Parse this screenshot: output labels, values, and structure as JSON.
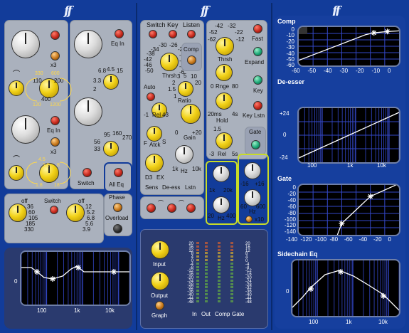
{
  "logo": "ff",
  "left": {
    "buttons": [
      "Switch",
      "All Eq",
      "Phase",
      "Overload"
    ],
    "eq_in_1": "Eq In",
    "eq_in_2": "Eq In",
    "eq_in_3": "Eq In",
    "x3_a": "x3",
    "x3_b": "x3",
    "band1_scale": [
      "330",
      "600",
      "110",
      "200",
      "400",
      "120",
      "1200"
    ],
    "band2_scale": [
      "4.5",
      "1.5",
      "8",
      "1.8",
      "18"
    ],
    "band3_scale": [
      "4.5",
      "6.8",
      "10",
      "15",
      "3.3",
      "2"
    ],
    "band4_scale": [
      "95",
      "160",
      "270",
      "56",
      "33"
    ],
    "hpf_switch": "Switch",
    "hpf1_scale": [
      "off",
      "36",
      "60",
      "105",
      "185",
      "330"
    ],
    "hpf2_scale": [
      "off",
      "12",
      "5.2",
      "6.8",
      "5.6",
      "3.9"
    ],
    "eq_graph": {
      "y_label": "0",
      "x_labels": [
        "100",
        "1k",
        "10k"
      ]
    }
  },
  "mid": {
    "tabs": [
      "Switch",
      "Key",
      "Listen"
    ],
    "comp_button": "Comp",
    "comp_thresh_scale": [
      "-30",
      "-26",
      "-22",
      "-34",
      "-18",
      "-38",
      "-14",
      "-42",
      "-10",
      "-46",
      "-6",
      "-50"
    ],
    "thrsh": "Thrsh",
    "auto": "Auto",
    "ratio": "Ratio",
    "ratio_scale": [
      "3",
      "5",
      "10",
      "2",
      "20",
      "1.5",
      "1"
    ],
    "rel": "Rel",
    "rel_scale": [
      "-1",
      "43"
    ],
    "atck": "Atck",
    "atck_scale": [
      "F",
      "S"
    ],
    "gain": "Gain",
    "gain_scale": [
      "0",
      "+20"
    ],
    "deess": {
      "sens": "Sens",
      "title": "De-ess",
      "listen": "Lstn",
      "d3": "D3",
      "ex": "EX",
      "k1": "1k",
      "hz": "Hz",
      "k10": "10k"
    },
    "gate_thresh_scale": [
      "-42",
      "-32",
      "-52",
      "-22",
      "-62",
      "-12"
    ],
    "gate_rnge": "Rnge",
    "gate_rnge_scale": [
      "0",
      "80"
    ],
    "gate_hold": "Hold",
    "gate_hold_scale": [
      "20ms",
      "4s"
    ],
    "gate_rel": "Rel",
    "gate_rel_scale": [
      "1.5",
      "-3",
      "5s"
    ],
    "fast": "Fast",
    "expand": "Expand",
    "key": "Key",
    "key_lstn": "Key Lstn",
    "gate_button": "Gate",
    "sc_lpf": {
      "scale": [
        "1k",
        "20k"
      ],
      "hz": "Hz",
      "low": "20",
      "high": "400"
    },
    "sc_hpf": {
      "scale": [
        "-16",
        "+16"
      ],
      "hz": "Hz",
      "low": "60",
      "high": "600",
      "x10": "x10"
    },
    "input": "Input",
    "output": "Output",
    "graph": "Graph",
    "meter_scale": [
      "20",
      "16",
      "12",
      "8",
      "4",
      "0",
      "-4",
      "-8",
      "-12",
      "-16",
      "-20",
      "-24",
      "-28",
      "-32",
      "-36",
      "-40",
      "-44",
      "-48"
    ],
    "meter_right_scale": [
      "20",
      "16",
      "12",
      "8",
      "4",
      "0",
      "-4",
      "-8",
      "-12",
      "-16",
      "-20",
      "-24",
      "-28",
      "-32",
      "-36",
      "-40",
      "-44",
      "-48"
    ],
    "meter_labels": [
      "In",
      "Out",
      "Comp",
      "Gate"
    ]
  },
  "right": {
    "comp": {
      "title": "Comp",
      "y_labels": [
        "0",
        "-10",
        "-20",
        "-30",
        "-40",
        "-50",
        "-60"
      ],
      "x_labels": [
        "-60",
        "-50",
        "-40",
        "-30",
        "-20",
        "-10",
        "0"
      ]
    },
    "deesser": {
      "title": "De-esser",
      "y_labels": [
        "+24",
        "0",
        "-24"
      ],
      "x_labels": [
        "100",
        "1k",
        "10k"
      ]
    },
    "gate": {
      "title": "Gate",
      "y_labels": [
        "0",
        "-20",
        "-40",
        "-60",
        "-80",
        "-100",
        "-120",
        "-140"
      ],
      "x_labels": [
        "-140",
        "-120",
        "-100",
        "-80",
        "-60",
        "-40",
        "-20",
        "0"
      ]
    },
    "sidechain": {
      "title": "Sidechain Eq",
      "y_label": "0",
      "x_labels": [
        "100",
        "1k",
        "10k"
      ]
    }
  },
  "colors": {
    "bg": "#123c9a",
    "panel": "#aab1bd",
    "accent": "#f2d218",
    "graph_line": "#ffffff"
  }
}
